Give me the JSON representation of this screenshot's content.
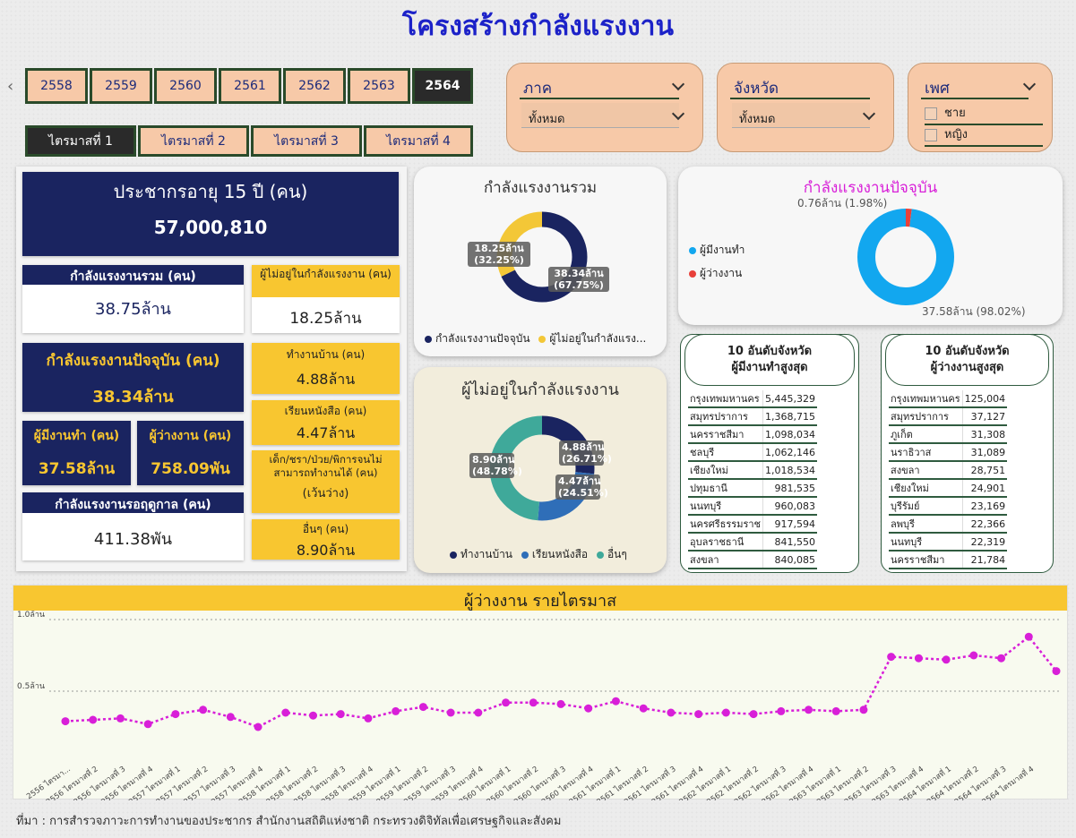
{
  "title": "โครงสร้างกำลังแรงงาน",
  "years": [
    "2558",
    "2559",
    "2560",
    "2561",
    "2562",
    "2563",
    "2564"
  ],
  "active_year": "2564",
  "quarters": [
    "ไตรมาสที่ 1",
    "ไตรมาสที่ 2",
    "ไตรมาสที่ 3",
    "ไตรมาสที่ 4"
  ],
  "filters": {
    "region": {
      "label": "ภาค",
      "value": "ทั้งหมด"
    },
    "province": {
      "label": "จังหวัด",
      "value": "ทั้งหมด"
    },
    "sex": {
      "label": "เพศ",
      "options": [
        "ชาย",
        "หญิง"
      ]
    }
  },
  "kpis": {
    "pop15_label": "ประชากรอายุ 15 ปี (คน)",
    "pop15_value": "57,000,810",
    "lf_total_label": "กำลังแรงงานรวม (คน)",
    "lf_total_value": "38.75ล้าน",
    "not_lf_label": "ผู้ไม่อยู่ในกำลังแรงงาน (คน)",
    "not_lf_value": "18.25ล้าน",
    "lf_current_label": "กำลังแรงงานปัจจุบัน (คน)",
    "lf_current_value": "38.34ล้าน",
    "housework_label": "ทำงานบ้าน (คน)",
    "housework_value": "4.88ล้าน",
    "study_label": "เรียนหนังสือ (คน)",
    "study_value": "4.47ล้าน",
    "employed_label": "ผู้มีงานทำ (คน)",
    "employed_value": "37.58ล้าน",
    "unemployed_label": "ผู้ว่างงาน (คน)",
    "unemployed_value": "758.09พัน",
    "unable_label": "เด็ก/ชรา/ป่วย/พิการจนไม่สามารถทำงานได้ (คน)",
    "unable_value": "(เว้นว่าง)",
    "seasonal_label": "กำลังแรงงานรอฤดูกาล (คน)",
    "seasonal_value": "411.38พัน",
    "other_label": "อื่นๆ (คน)",
    "other_value": "8.90ล้าน"
  },
  "donut_total": {
    "title": "กำลังแรงงานรวม",
    "label_a": "38.34ล้าน (67.75%)",
    "label_b": "18.25ล้าน (32.25%)",
    "legend_a": "กำลังแรงงานปัจจุบัน",
    "legend_b": "ผู้ไม่อยู่ในกำลังแรง...",
    "color_a": "#1a2460",
    "color_b": "#f3c737"
  },
  "donut_current": {
    "title": "กำลังแรงงานปัจจุบัน",
    "label_a": "37.58ล้าน (98.02%)",
    "label_b": "0.76ล้าน (1.98%)",
    "legend_a": "ผู้มีงานทำ",
    "legend_b": "ผู้ว่างงาน",
    "color_a": "#12a7ef",
    "color_b": "#e8403a"
  },
  "donut_notlf": {
    "title": "ผู้ไม่อยู่ในกำลังแรงงาน",
    "label_a": "4.88ล้าน (26.71%)",
    "label_b": "4.47ล้าน (24.51%)",
    "label_c": "8.90ล้าน (48.78%)",
    "legend_a": "ทำงานบ้าน",
    "legend_b": "เรียนหนังสือ",
    "legend_c": "อื่นๆ",
    "color_a": "#1a2460",
    "color_b": "#2f6eb8",
    "color_c": "#3fa99a"
  },
  "rank_employed": {
    "title1": "10 อันดับจังหวัด",
    "title2": "ผู้มีงานทำสูงสุด",
    "rows": [
      [
        "กรุงเทพมหานคร",
        "5,445,329"
      ],
      [
        "สมุทรปราการ",
        "1,368,715"
      ],
      [
        "นครราชสีมา",
        "1,098,034"
      ],
      [
        "ชลบุรี",
        "1,062,146"
      ],
      [
        "เชียงใหม่",
        "1,018,534"
      ],
      [
        "ปทุมธานี",
        "981,535"
      ],
      [
        "นนทบุรี",
        "960,083"
      ],
      [
        "นครศรีธรรมราช",
        "917,594"
      ],
      [
        "อุบลราชธานี",
        "841,550"
      ],
      [
        "สงขลา",
        "840,085"
      ]
    ]
  },
  "rank_unemployed": {
    "title1": "10 อันดับจังหวัด",
    "title2": "ผู้ว่างงานสูงสุด",
    "rows": [
      [
        "กรุงเทพมหานคร",
        "125,004"
      ],
      [
        "สมุทรปราการ",
        "37,127"
      ],
      [
        "ภูเก็ต",
        "31,308"
      ],
      [
        "นราธิวาส",
        "31,089"
      ],
      [
        "สงขลา",
        "28,751"
      ],
      [
        "เชียงใหม่",
        "24,901"
      ],
      [
        "บุรีรัมย์",
        "23,169"
      ],
      [
        "ลพบุรี",
        "22,366"
      ],
      [
        "นนทบุรี",
        "22,319"
      ],
      [
        "นครราชสีมา",
        "21,784"
      ]
    ]
  },
  "chart_data": {
    "type": "line",
    "title": "ผู้ว่างงาน รายไตรมาส",
    "y_ticks": [
      "1.0ล้าน",
      "0.5ล้าน"
    ],
    "ylim": [
      0,
      1.0
    ],
    "color": "#d81fd8",
    "x": [
      "2556 ไตรมา...",
      "2556 ไตรมาสที่ 2",
      "2556 ไตรมาสที่ 3",
      "2556 ไตรมาสที่ 4",
      "2557 ไตรมาสที่ 1",
      "2557 ไตรมาสที่ 2",
      "2557 ไตรมาสที่ 3",
      "2557 ไตรมาสที่ 4",
      "2558 ไตรมาสที่ 1",
      "2558 ไตรมาสที่ 2",
      "2558 ไตรมาสที่ 3",
      "2558 ไตรมาสที่ 4",
      "2559 ไตรมาสที่ 1",
      "2559 ไตรมาสที่ 2",
      "2559 ไตรมาสที่ 3",
      "2559 ไตรมาสที่ 4",
      "2560 ไตรมาสที่ 1",
      "2560 ไตรมาสที่ 2",
      "2560 ไตรมาสที่ 3",
      "2560 ไตรมาสที่ 4",
      "2561 ไตรมาสที่ 1",
      "2561 ไตรมาสที่ 2",
      "2561 ไตรมาสที่ 3",
      "2561 ไตรมาสที่ 4",
      "2562 ไตรมาสที่ 1",
      "2562 ไตรมาสที่ 2",
      "2562 ไตรมาสที่ 3",
      "2562 ไตรมาสที่ 4",
      "2563 ไตรมาสที่ 1",
      "2563 ไตรมาสที่ 2",
      "2563 ไตรมาสที่ 3",
      "2563 ไตรมาสที่ 4",
      "2564 ไตรมาสที่ 1",
      "2564 ไตรมาสที่ 2",
      "2564 ไตรมาสที่ 3",
      "2564 ไตรมาสที่ 4"
    ],
    "values": [
      0.29,
      0.3,
      0.31,
      0.27,
      0.34,
      0.37,
      0.32,
      0.25,
      0.35,
      0.33,
      0.34,
      0.31,
      0.36,
      0.39,
      0.35,
      0.35,
      0.42,
      0.42,
      0.41,
      0.38,
      0.43,
      0.38,
      0.35,
      0.34,
      0.35,
      0.34,
      0.36,
      0.37,
      0.36,
      0.37,
      0.74,
      0.73,
      0.72,
      0.75,
      0.73,
      0.88,
      0.64
    ]
  },
  "footer": "ที่มา : การสำรวจภาวะการทำงานของประชากร สำนักงานสถิติแห่งชาติ กระทรวงดิจิทัลเพื่อเศรษฐกิจและสังคม"
}
